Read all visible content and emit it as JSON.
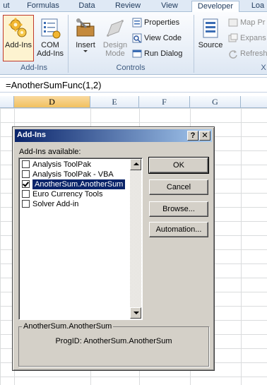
{
  "tabs": [
    "ut",
    "Formulas",
    "Data",
    "Review",
    "View",
    "Developer",
    "Loa"
  ],
  "ribbon": {
    "addins_btn": "Add-Ins",
    "com_line1": "COM",
    "com_line2": "Add-Ins",
    "group_addins": "Add-Ins",
    "insert_label": "Insert",
    "design_line1": "Design",
    "design_line2": "Mode",
    "properties": "Properties",
    "view_code": "View Code",
    "run_dialog": "Run Dialog",
    "group_controls": "Controls",
    "source": "Source",
    "map_props": "Map Pr",
    "expansion": "Expans",
    "refresh": "Refresh",
    "group_x": "X"
  },
  "formula": "=AnotherSumFunc(1,2)",
  "columns": [
    "D",
    "E",
    "F",
    "G"
  ],
  "dialog": {
    "title": "Add-Ins",
    "help_glyph": "?",
    "close_glyph": "✕",
    "available_label": "Add-Ins available:",
    "items": [
      {
        "label": "Analysis ToolPak",
        "checked": false,
        "selected": false
      },
      {
        "label": "Analysis ToolPak - VBA",
        "checked": false,
        "selected": false
      },
      {
        "label": "AnotherSum.AnotherSum",
        "checked": true,
        "selected": true
      },
      {
        "label": "Euro Currency Tools",
        "checked": false,
        "selected": false
      },
      {
        "label": "Solver Add-in",
        "checked": false,
        "selected": false
      }
    ],
    "buttons": {
      "ok": "OK",
      "cancel": "Cancel",
      "browse": "Browse...",
      "automation": "Automation..."
    },
    "groupbox_title": "AnotherSum.AnotherSum",
    "description": "ProgID: AnotherSum.AnotherSum"
  },
  "colors": {
    "title_gradient_start": "#0a246a",
    "title_gradient_end": "#a6caf0",
    "selection": "#0a246a",
    "ribbon_tab_text": "#1e395b"
  }
}
